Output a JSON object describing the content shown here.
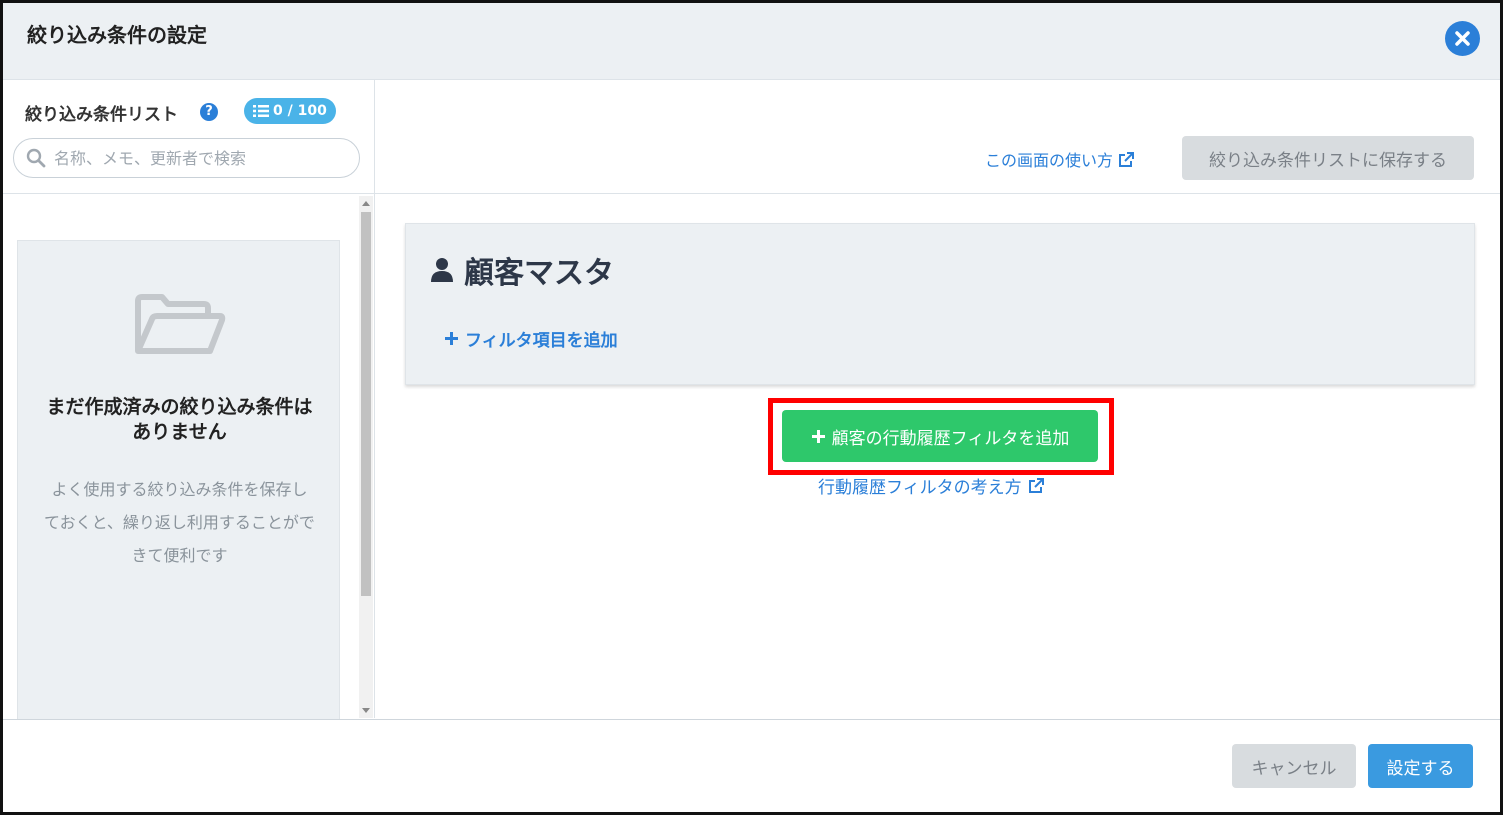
{
  "dialog": {
    "title": "絞り込み条件の設定"
  },
  "left": {
    "list_title": "絞り込み条件リスト",
    "count_badge": "0 / 100",
    "search_placeholder": "名称、メモ、更新者で検索",
    "empty_title": "まだ作成済みの絞り込み条件はありません",
    "empty_desc": "よく使用する絞り込み条件を保存しておくと、繰り返し利用することができて便利です"
  },
  "right": {
    "howto_link": "この画面の使い方",
    "save_list_button": "絞り込み条件リストに保存する",
    "master_title": "顧客マスタ",
    "add_filter_item": "フィルタ項目を追加",
    "add_behavior_filter": "顧客の行動履歴フィルタを追加",
    "behavior_concept_link": "行動履歴フィルタの考え方"
  },
  "footer": {
    "cancel": "キャンセル",
    "apply": "設定する"
  },
  "colors": {
    "accent": "#2b7fd8",
    "green": "#2ec86b",
    "highlight": "#ff0000"
  }
}
